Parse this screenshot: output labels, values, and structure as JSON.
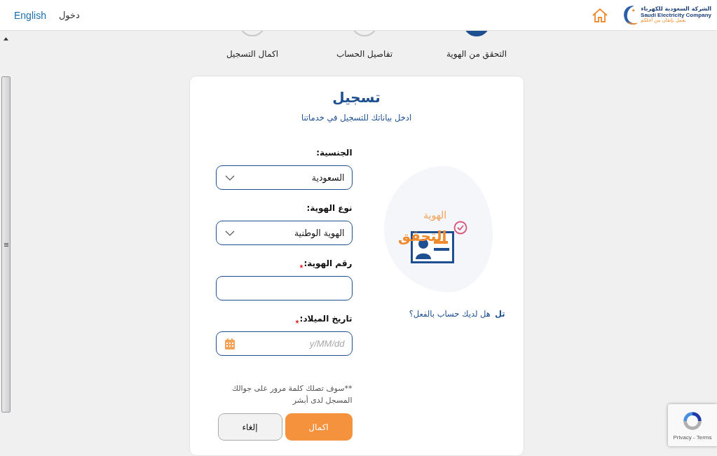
{
  "header": {
    "language_link": "English",
    "login_link": "دخول",
    "logo": {
      "name_ar": "الشركة السعودية للكهرباء",
      "name_en": "Saudi Electricity Company",
      "slogan": "نعمل بإتقان من أجلكم"
    }
  },
  "steps": [
    {
      "label": "التحقق من الهوية",
      "selected": true
    },
    {
      "label": "تفاصيل الحساب",
      "selected": false
    },
    {
      "label": "اكمال التسجيل",
      "selected": false
    }
  ],
  "form": {
    "title": "تسجيل",
    "subtitle": "ادخل بياناتك للتسجيل في خدماتنا",
    "fields": [
      {
        "kind": "select",
        "label": "الجنسية:",
        "required": false,
        "value": "السعودية"
      },
      {
        "kind": "select",
        "label": "نوع الهوية:",
        "required": false,
        "value": "الهوية الوطنية"
      },
      {
        "kind": "text",
        "label": "رقم الهوية:",
        "required": true
      },
      {
        "kind": "date",
        "label": "تاريخ الميلاد:",
        "required": true,
        "placeholder": "y/MM/dd"
      }
    ],
    "note": "**سوف تصلك كلمة مرور على جوالك المسجل لدى أبشر",
    "buttons": [
      {
        "kind": "primary",
        "label": "اكمال"
      },
      {
        "kind": "secondary",
        "label": "إلغاء"
      }
    ]
  },
  "illustration": {
    "caption_top": "الهوية",
    "caption_main": "التحقق",
    "question": "هل لديك حساب بالفعل؟",
    "login_link": "تل"
  },
  "recaptcha": {
    "links": "Privacy - Terms"
  }
}
